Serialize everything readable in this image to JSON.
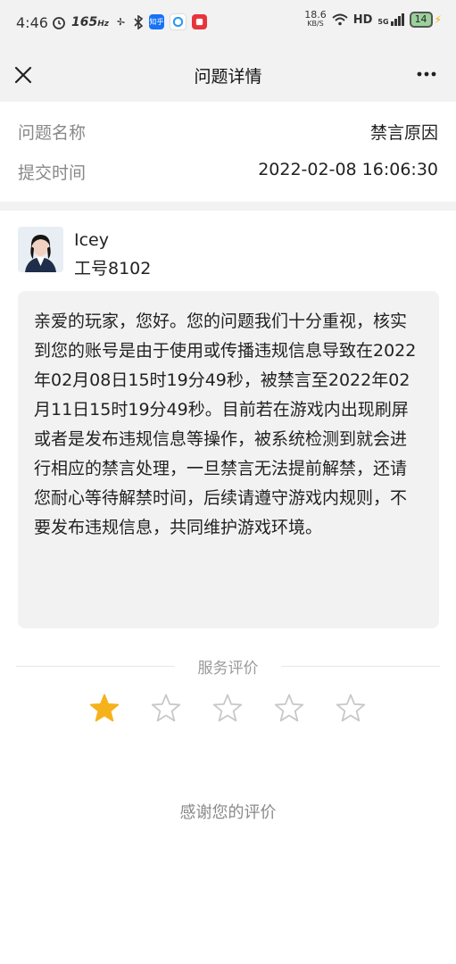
{
  "status_bar": {
    "time": "4:46",
    "refresh_rate": "165",
    "refresh_unit": "Hz",
    "app_icons": [
      "知乎"
    ],
    "net_speed_value": "18.6",
    "net_speed_unit": "KB/S",
    "hd_label": "HD",
    "network": "5G",
    "battery_level": "14"
  },
  "nav": {
    "title": "问题详情"
  },
  "info": {
    "name_label": "问题名称",
    "name_value": "禁言原因",
    "time_label": "提交时间",
    "time_value": "2022-02-08 16:06:30"
  },
  "agent": {
    "name": "Icey",
    "id_text": "工号8102"
  },
  "message": {
    "text": "亲爱的玩家，您好。您的问题我们十分重视，核实到您的账号是由于使用或传播违规信息导致在2022年02月08日15时19分49秒，被禁言至2022年02月11日15时19分49秒。目前若在游戏内出现刷屏或者是发布违规信息等操作，被系统检测到就会进行相应的禁言处理，一旦禁言无法提前解禁，还请您耐心等待解禁时间，后续请遵守游戏内规则，不要发布违规信息，共同维护游戏环境。"
  },
  "rating": {
    "label": "服务评价",
    "max": 5,
    "value": 1,
    "thanks": "感谢您的评价"
  },
  "colors": {
    "star_active": "#f5b21b",
    "star_inactive": "#c8c8c8",
    "bubble_bg": "#f2f2f2"
  }
}
